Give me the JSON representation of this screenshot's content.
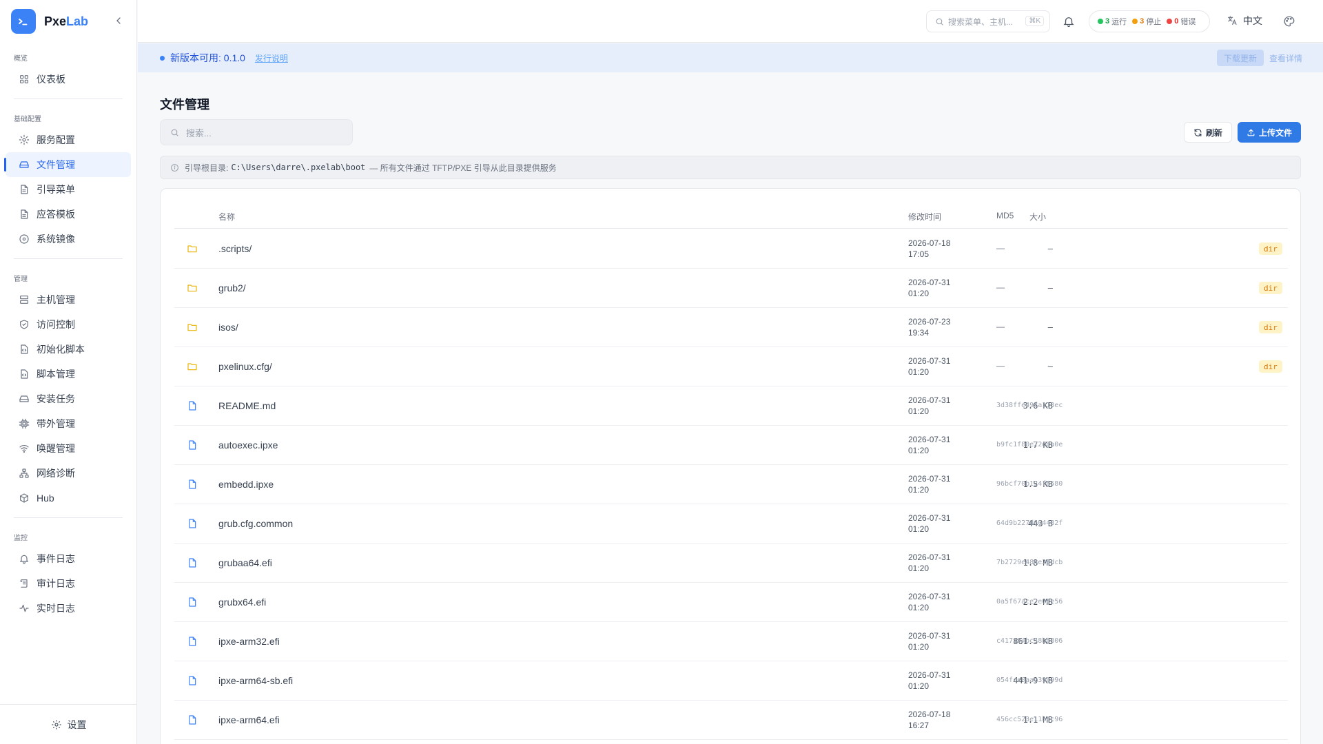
{
  "app": {
    "brand_a": "Pxe",
    "brand_b": "Lab"
  },
  "sidebar": {
    "sections": [
      {
        "label": "概览",
        "items": [
          {
            "label": "仪表板",
            "icon": "dashboard-icon"
          }
        ]
      },
      {
        "label": "基础配置",
        "items": [
          {
            "label": "服务配置",
            "icon": "gear-icon"
          },
          {
            "label": "文件管理",
            "icon": "drive-icon",
            "active": true
          },
          {
            "label": "引导菜单",
            "icon": "file-icon"
          },
          {
            "label": "应答模板",
            "icon": "file-icon"
          },
          {
            "label": "系统镜像",
            "icon": "disc-icon"
          }
        ]
      },
      {
        "label": "管理",
        "items": [
          {
            "label": "主机管理",
            "icon": "server-icon"
          },
          {
            "label": "访问控制",
            "icon": "shield-icon"
          },
          {
            "label": "初始化脚本",
            "icon": "file-code-icon"
          },
          {
            "label": "脚本管理",
            "icon": "file-code-icon"
          },
          {
            "label": "安装任务",
            "icon": "drive-icon"
          },
          {
            "label": "带外管理",
            "icon": "chip-icon"
          },
          {
            "label": "唤醒管理",
            "icon": "wifi-icon"
          },
          {
            "label": "网络诊断",
            "icon": "network-icon"
          },
          {
            "label": "Hub",
            "icon": "box-icon"
          }
        ]
      },
      {
        "label": "监控",
        "items": [
          {
            "label": "事件日志",
            "icon": "bell-icon"
          },
          {
            "label": "审计日志",
            "icon": "scroll-icon"
          },
          {
            "label": "实时日志",
            "icon": "activity-icon"
          }
        ]
      }
    ],
    "settings_label": "设置"
  },
  "topbar": {
    "search_placeholder": "搜索菜单、主机...",
    "search_kbd": "⌘K",
    "status": [
      {
        "count": "3",
        "label": "运行",
        "color": "#22c55e"
      },
      {
        "count": "3",
        "label": "停止",
        "color": "#f59e0b"
      },
      {
        "count": "0",
        "label": "错误",
        "color": "#ef4444"
      }
    ],
    "language": "中文"
  },
  "banner": {
    "text": "新版本可用: 0.1.0",
    "link": "发行说明",
    "download": "下载更新",
    "view": "查看详情"
  },
  "main": {
    "title": "文件管理",
    "search_placeholder": "搜索...",
    "refresh_label": "刷新",
    "upload_label": "上传文件",
    "root_label": "引导根目录:",
    "root_path": "C:\\Users\\darre\\.pxelab\\boot",
    "root_note": "— 所有文件通过 TFTP/PXE 引导从此目录提供服务"
  },
  "table": {
    "headers": {
      "name": "名称",
      "size": "大小",
      "mtime": "修改时间",
      "md5": "MD5"
    },
    "rows": [
      {
        "type": "dir",
        "name": ".scripts/",
        "size": "—",
        "date": "2026-07-18",
        "time": "17:05",
        "md5": "—",
        "badge": "dir"
      },
      {
        "type": "dir",
        "name": "grub2/",
        "size": "—",
        "date": "2026-07-31",
        "time": "01:20",
        "md5": "—",
        "badge": "dir"
      },
      {
        "type": "dir",
        "name": "isos/",
        "size": "—",
        "date": "2026-07-23",
        "time": "19:34",
        "md5": "—",
        "badge": "dir"
      },
      {
        "type": "dir",
        "name": "pxelinux.cfg/",
        "size": "—",
        "date": "2026-07-31",
        "time": "01:20",
        "md5": "—",
        "badge": "dir"
      },
      {
        "type": "file",
        "name": "README.md",
        "size": "3.6 KB",
        "date": "2026-07-31",
        "time": "01:20",
        "md5": "3d38ffe49fa113ec"
      },
      {
        "type": "file",
        "name": "autoexec.ipxe",
        "size": "1.7 KB",
        "date": "2026-07-31",
        "time": "01:20",
        "md5": "b9fc1f80e22dca0e"
      },
      {
        "type": "file",
        "name": "embedd.ipxe",
        "size": "1.5 KB",
        "date": "2026-07-31",
        "time": "01:20",
        "md5": "96bcf70b124f6580"
      },
      {
        "type": "file",
        "name": "grub.cfg.common",
        "size": "443 B",
        "date": "2026-07-31",
        "time": "01:20",
        "md5": "64d9b227d604482f"
      },
      {
        "type": "file",
        "name": "grubaa64.efi",
        "size": "1.8 MB",
        "date": "2026-07-31",
        "time": "01:20",
        "md5": "7b2729e484e25dcb"
      },
      {
        "type": "file",
        "name": "grubx64.efi",
        "size": "2.2 MB",
        "date": "2026-07-31",
        "time": "01:20",
        "md5": "0a5f67ace2e0ce56"
      },
      {
        "type": "file",
        "name": "ipxe-arm32.efi",
        "size": "861.5 KB",
        "date": "2026-07-31",
        "time": "01:20",
        "md5": "c417194bc38bb806"
      },
      {
        "type": "file",
        "name": "ipxe-arm64-sb.efi",
        "size": "441.9 KB",
        "date": "2026-07-31",
        "time": "01:20",
        "md5": "054fce0aac39c99d"
      },
      {
        "type": "file",
        "name": "ipxe-arm64.efi",
        "size": "1.1 MB",
        "date": "2026-07-18",
        "time": "16:27",
        "md5": "456cc523e11bcc96"
      }
    ]
  }
}
